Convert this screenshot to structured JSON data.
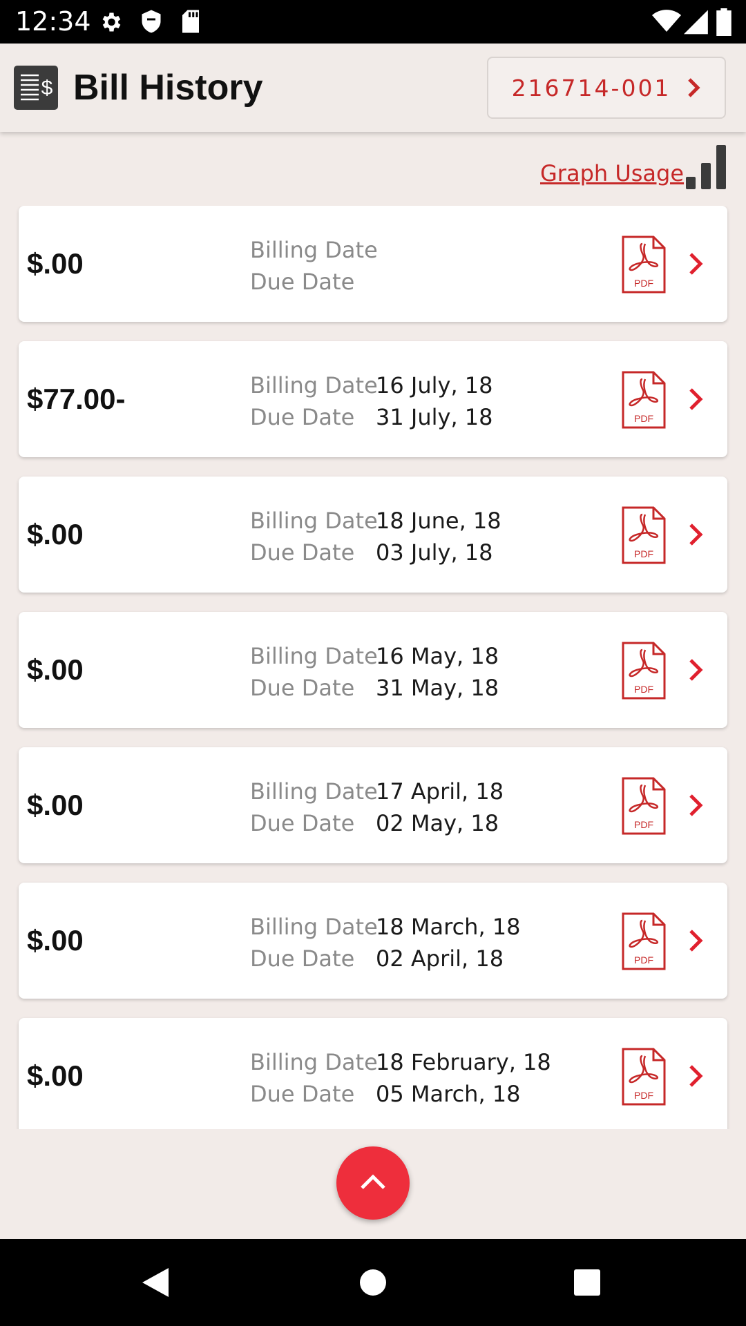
{
  "status_bar": {
    "time": "12:34",
    "icons": [
      "gear-icon",
      "shield-icon",
      "sd-card-icon",
      "wifi-icon",
      "signal-icon",
      "battery-icon"
    ]
  },
  "header": {
    "title": "Bill History",
    "icon": "bill-dollar-icon",
    "account_number": "216714-001",
    "account_chevron": "chevron-right-icon"
  },
  "graph_usage": {
    "label": "Graph Usage",
    "icon": "bar-chart-icon"
  },
  "bills": [
    {
      "amount": "$.00",
      "billing_label": "Billing Date",
      "billing_date": "",
      "due_label": "Due Date",
      "due_date": ""
    },
    {
      "amount": "$77.00-",
      "billing_label": "Billing Date",
      "billing_date": "16 July, 18",
      "due_label": "Due Date",
      "due_date": "31 July, 18"
    },
    {
      "amount": "$.00",
      "billing_label": "Billing Date",
      "billing_date": "18 June, 18",
      "due_label": "Due Date",
      "due_date": "03 July, 18"
    },
    {
      "amount": "$.00",
      "billing_label": "Billing Date",
      "billing_date": "16 May, 18",
      "due_label": "Due Date",
      "due_date": "31 May, 18"
    },
    {
      "amount": "$.00",
      "billing_label": "Billing Date",
      "billing_date": "17 April, 18",
      "due_label": "Due Date",
      "due_date": "02 May, 18"
    },
    {
      "amount": "$.00",
      "billing_label": "Billing Date",
      "billing_date": "18 March, 18",
      "due_label": "Due Date",
      "due_date": "02 April, 18"
    },
    {
      "amount": "$.00",
      "billing_label": "Billing Date",
      "billing_date": "18 February, 18",
      "due_label": "Due Date",
      "due_date": "05 March, 18"
    }
  ],
  "pdf_label": "PDF",
  "colors": {
    "accent": "#c62828",
    "fab": "#ee2e3c",
    "background": "#f2ebe8"
  },
  "fab": {
    "icon": "chevron-up-icon"
  },
  "nav_bar": {
    "icons": [
      "back-icon",
      "home-icon",
      "recents-icon"
    ]
  }
}
